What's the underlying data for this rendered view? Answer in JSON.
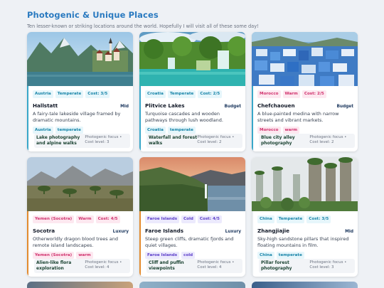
{
  "header": {
    "title": "Photogenic & Unique Places",
    "subtitle": "Ten lesser-known or striking locations around the world. Hopefully I will visit all of these some day!"
  },
  "colors": {
    "accent": "#2a7ac0",
    "teal": "#38a7c9",
    "pink": "#d0306c",
    "violet": "#5a3cc8"
  },
  "places": [
    {
      "region": "Austria",
      "vibe": "Temperate",
      "cost": "Cost: 3/5",
      "name": "Hallstatt",
      "budget": "Mid",
      "description": "A fairy-tale lakeside village framed by dramatic mountains.",
      "chip_region": "Austria",
      "chip_vibe": "temperate",
      "focus": "Lake photography and alpine walks",
      "focus_label": "Photogenic focus •",
      "cost_level": "Cost level: 3",
      "palette": "teal"
    },
    {
      "region": "Croatia",
      "vibe": "Temperate",
      "cost": "Cost: 2/5",
      "name": "Plitvice Lakes",
      "budget": "Budget",
      "description": "Turquoise cascades and wooden pathways through lush woodland.",
      "chip_region": "Croatia",
      "chip_vibe": "temperate",
      "focus": "Waterfall and forest walks",
      "focus_label": "Photogenic focus •",
      "cost_level": "Cost level: 2",
      "palette": "teal"
    },
    {
      "region": "Morocco",
      "vibe": "Warm",
      "cost": "Cost: 2/5",
      "name": "Chefchaouen",
      "budget": "Budget",
      "description": "A blue-painted medina with narrow streets and vibrant markets.",
      "chip_region": "Morocco",
      "chip_vibe": "warm",
      "focus": "Blue city alley photography",
      "focus_label": "Photogenic focus •",
      "cost_level": "Cost level: 2",
      "palette": "pink"
    },
    {
      "region": "Yemen (Socotra)",
      "vibe": "Warm",
      "cost": "Cost: 4/5",
      "name": "Socotra",
      "budget": "Luxury",
      "description": "Otherworldly dragon blood trees and remote island landscapes.",
      "chip_region": "Yemen (Socotra)",
      "chip_vibe": "warm",
      "focus": "Alien-like flora exploration",
      "focus_label": "Photogenic focus •",
      "cost_level": "Cost level: 4",
      "palette": "pink"
    },
    {
      "region": "Faroe Islands",
      "vibe": "Cold",
      "cost": "Cost: 4/5",
      "name": "Faroe Islands",
      "budget": "Luxury",
      "description": "Steep green cliffs, dramatic fjords and quiet villages.",
      "chip_region": "Faroe Islands",
      "chip_vibe": "cold",
      "focus": "Cliff and puffin viewpoints",
      "focus_label": "Photogenic focus •",
      "cost_level": "Cost level: 4",
      "palette": "violet"
    },
    {
      "region": "China",
      "vibe": "Temperate",
      "cost": "Cost: 3/5",
      "name": "Zhangjiajie",
      "budget": "Mid",
      "description": "Sky-high sandstone pillars that inspired floating mountains in film.",
      "chip_region": "China",
      "chip_vibe": "temperate",
      "focus": "Pillar forest photography",
      "focus_label": "Photogenic focus •",
      "cost_level": "Cost level: 3",
      "palette": "teal"
    }
  ]
}
